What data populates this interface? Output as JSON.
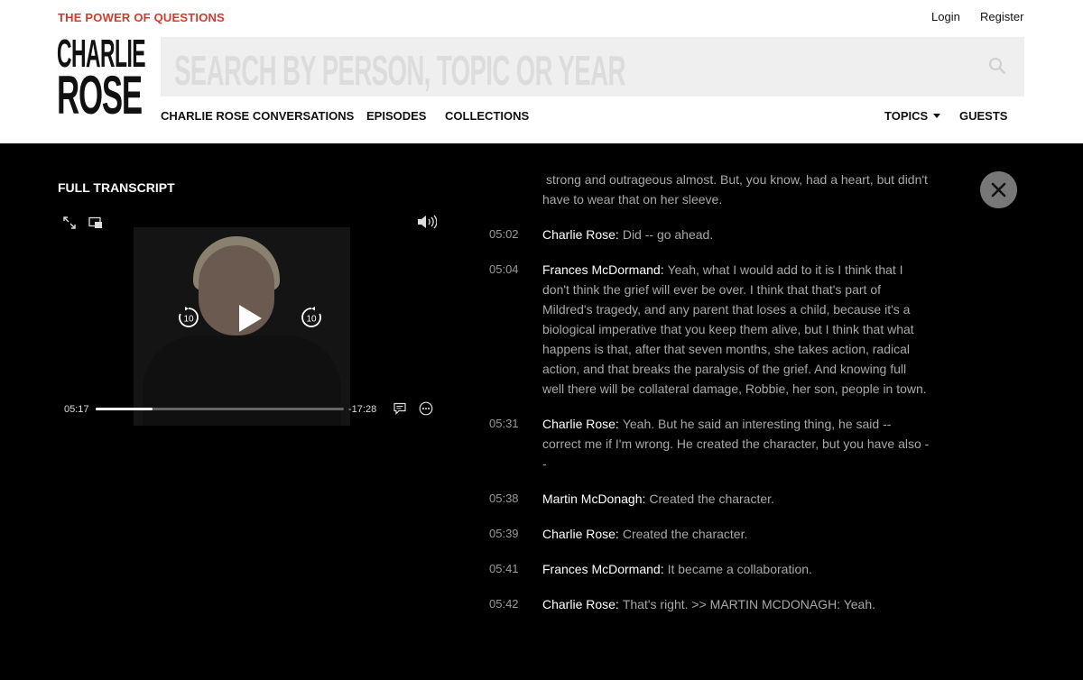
{
  "header": {
    "tagline": "THE POWER OF QUESTIONS",
    "login": "Login",
    "register": "Register",
    "logo_line1": "CHARLIE",
    "logo_line2": "ROSE",
    "search_placeholder": "SEARCH BY PERSON, TOPIC OR YEAR",
    "nav": {
      "conversations": "CHARLIE ROSE CONVERSATIONS",
      "episodes": "EPISODES",
      "collections": "COLLECTIONS",
      "topics": "TOPICS",
      "guests": "GUESTS"
    }
  },
  "transcript_panel": {
    "title": "FULL TRANSCRIPT",
    "player": {
      "current_time": "05:17",
      "remaining_time": "-17:28",
      "progress_fraction": 0.23,
      "skip_seconds": "10",
      "icons": [
        "expand-icon",
        "pip-icon",
        "volume-icon",
        "rewind-10-icon",
        "play-icon",
        "forward-10-icon",
        "captions-icon",
        "more-icon"
      ]
    },
    "lines": [
      {
        "time": "",
        "speaker": "",
        "text": "strong and outrageous almost. But, you know, had a heart, but didn't have to wear that on her sleeve."
      },
      {
        "time": "05:02",
        "speaker": "Charlie Rose:",
        "text": "Did -- go ahead."
      },
      {
        "time": "05:04",
        "speaker": "Frances McDormand:",
        "text": "Yeah, what I would add to it is I think that I don't think the grief will ever be over. I think that that's part of Mildred's tragedy, and any parent that loses a child, because it's a biological imperative that you keep them alive, but I think that what happens is that, after that seven months, she takes action, radical action, and that breaks the paralysis of the grief. And knowing full well there will be collateral damage, Robbie, her son, people in town."
      },
      {
        "time": "05:31",
        "speaker": "Charlie Rose:",
        "text": "Yeah. But he said an interesting thing, he said -- correct me if I'm wrong. He created the character, but you have also --"
      },
      {
        "time": "05:38",
        "speaker": "Martin McDonagh:",
        "text": "Created the character."
      },
      {
        "time": "05:39",
        "speaker": "Charlie Rose:",
        "text": "Created the character."
      },
      {
        "time": "05:41",
        "speaker": "Frances McDormand:",
        "text": "It became a collaboration."
      },
      {
        "time": "05:42",
        "speaker": "Charlie Rose:",
        "text": "That's right. >> MARTIN MCDONAGH: Yeah."
      }
    ]
  },
  "colors": {
    "accent": "#d23b2c",
    "background_dark": "#000000",
    "header_bg": "#ffffff"
  }
}
